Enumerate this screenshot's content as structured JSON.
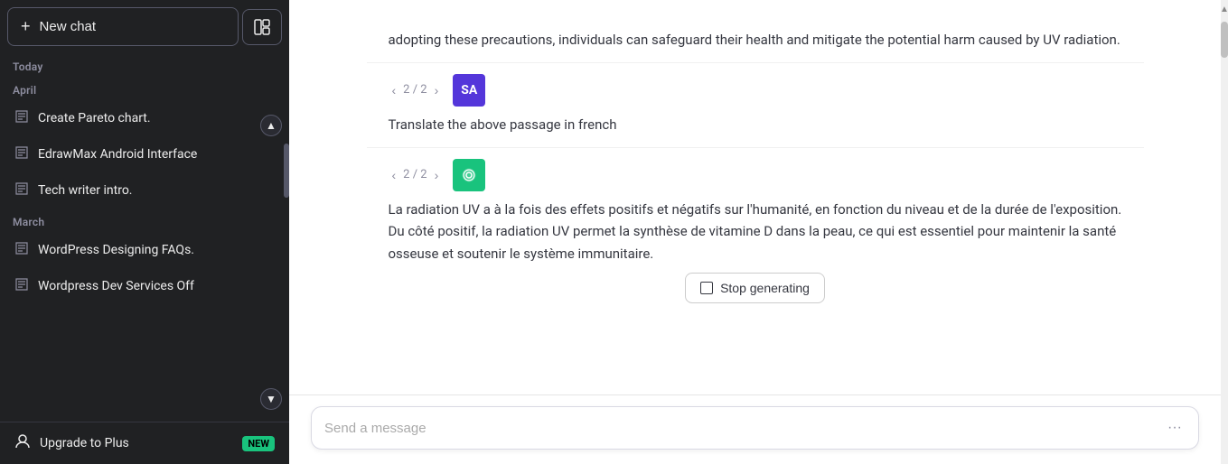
{
  "sidebar": {
    "new_chat_label": "New chat",
    "layout_icon": "⊞",
    "today_label": "Today",
    "april_label": "April",
    "march_label": "March",
    "chats": {
      "april": [
        {
          "id": "create-pareto",
          "label": "Create Pareto chart."
        },
        {
          "id": "edrawmax",
          "label": "EdrawMax Android Interface"
        },
        {
          "id": "tech-writer",
          "label": "Tech writer intro."
        }
      ],
      "march": [
        {
          "id": "wordpress-faq",
          "label": "WordPress Designing FAQs."
        },
        {
          "id": "wordpress-dev",
          "label": "Wordpress Dev Services Off"
        }
      ]
    },
    "upgrade": {
      "label": "Upgrade to Plus",
      "badge": "NEW"
    }
  },
  "chat": {
    "prev_text": "adopting these precautions, individuals can safeguard their health and mitigate the potential harm caused by UV radiation.",
    "user_message": {
      "nav": "2 / 2",
      "avatar": "SA",
      "text": "Translate the above passage in french"
    },
    "ai_message": {
      "nav": "2 / 2",
      "text": "La radiation UV a à la fois des effets positifs et négatifs sur l'humanité, en fonction du niveau et de la durée de l'exposition. Du côté positif, la radiation UV permet la synthèse de vitamine D dans la peau, ce qui est essentiel pour maintenir la santé osseuse et soutenir le système immunitaire.",
      "stop_btn": "Stop generating"
    }
  },
  "input": {
    "placeholder": "Send a message",
    "more_icon": "···"
  },
  "icons": {
    "chat_icon": "💬",
    "plus_icon": "+",
    "person_icon": "👤",
    "chevron_up": "▲",
    "chevron_down": "▼",
    "chevron_left": "‹",
    "chevron_right": "›",
    "openai_icon": "✦"
  }
}
